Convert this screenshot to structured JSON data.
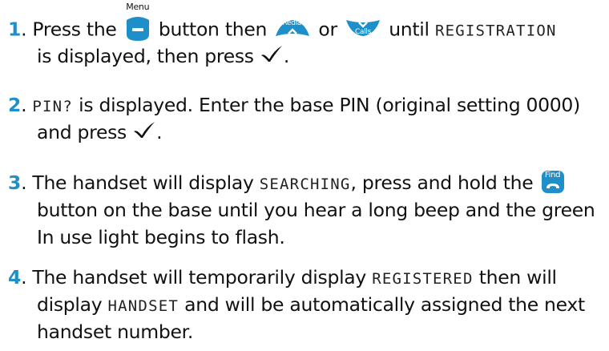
{
  "steps": [
    {
      "number": "1",
      "dot": ".",
      "text_a": " Press the ",
      "menu_label": "Menu",
      "text_b": " button then ",
      "redial_label": "Redial",
      "text_c": " or ",
      "calls_label": "Calls",
      "text_d": " until ",
      "lcd_1": "REGISTRATION",
      "text_e": "is displayed, then press ",
      "text_f": "."
    },
    {
      "number": "2",
      "dot": ".",
      "lcd_1": "PIN?",
      "text_a": " is displayed. Enter the base PIN (original setting 0000)",
      "text_b": "and press ",
      "text_c": "."
    },
    {
      "number": "3",
      "dot": ".",
      "text_a": " The handset will display ",
      "lcd_1": "SEARCHING",
      "text_b": ", press and hold the ",
      "find_label": "Find",
      "text_c": "button on the base until you hear a long beep and the green",
      "text_d": "In use light begins to flash."
    },
    {
      "number": "4",
      "dot": ".",
      "text_a": " The handset will temporarily display ",
      "lcd_1": "REGISTERED",
      "text_b": " then will",
      "text_c": "display ",
      "lcd_2": "HANDSET",
      "text_d": " and will be automatically assigned the next",
      "text_e": "handset number."
    }
  ],
  "colors": {
    "step_number": "#1f8fc9",
    "key_fill": "#1f8fc9",
    "text": "#111111"
  },
  "icons": [
    "menu-key-icon",
    "redial-up-key-icon",
    "calls-down-key-icon",
    "ok-tick-icon",
    "find-key-icon"
  ]
}
